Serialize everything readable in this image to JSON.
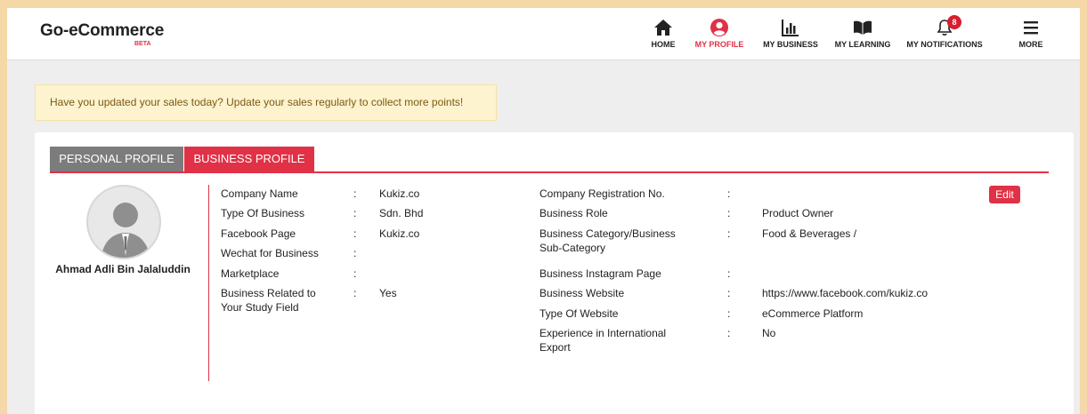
{
  "brand": {
    "name": "Go-eCommerce",
    "badge": "BETA"
  },
  "nav": {
    "home": "HOME",
    "profile": "MY PROFILE",
    "business": "MY BUSINESS",
    "learning": "MY LEARNING",
    "notifications": "MY NOTIFICATIONS",
    "notifications_count": "8",
    "more": "MORE"
  },
  "alert": {
    "text": "Have you updated your sales today? Update your sales regularly to collect more points!"
  },
  "tabs": {
    "personal": "PERSONAL PROFILE",
    "business": "BUSINESS PROFILE"
  },
  "user": {
    "name": "Ahmad Adli Bin Jalaluddin"
  },
  "left_fields": [
    {
      "label": "Company Name",
      "colon": ":",
      "value": "Kukiz.co"
    },
    {
      "label": "Type Of Business",
      "colon": ":",
      "value": "Sdn. Bhd"
    },
    {
      "label": "Facebook Page",
      "colon": ":",
      "value": "Kukiz.co"
    },
    {
      "label": "Wechat for Business",
      "colon": ":",
      "value": ""
    },
    {
      "label": "Marketplace",
      "colon": ":",
      "value": ""
    },
    {
      "label": "Business Related to Your Study Field",
      "colon": ":",
      "value": "Yes"
    }
  ],
  "right_fields": [
    {
      "label": "Company Registration No.",
      "colon": ":",
      "value": ""
    },
    {
      "label": "Business Role",
      "colon": ":",
      "value": "Product Owner"
    },
    {
      "label": "Business Category/Business Sub-Category",
      "colon": ":",
      "value": "Food & Beverages /"
    },
    {
      "label": "Business Instagram Page",
      "colon": ":",
      "value": ""
    },
    {
      "label": "Business Website",
      "colon": ":",
      "value": "https://www.facebook.com/kukiz.co"
    },
    {
      "label": "Type Of Website",
      "colon": ":",
      "value": "eCommerce Platform"
    },
    {
      "label": "Experience in International Export",
      "colon": ":",
      "value": "No"
    }
  ],
  "actions": {
    "edit": "Edit"
  },
  "colors": {
    "accent": "#e03146",
    "tab_inactive": "#7c7c7c",
    "alert_bg": "#fdf3cf"
  }
}
